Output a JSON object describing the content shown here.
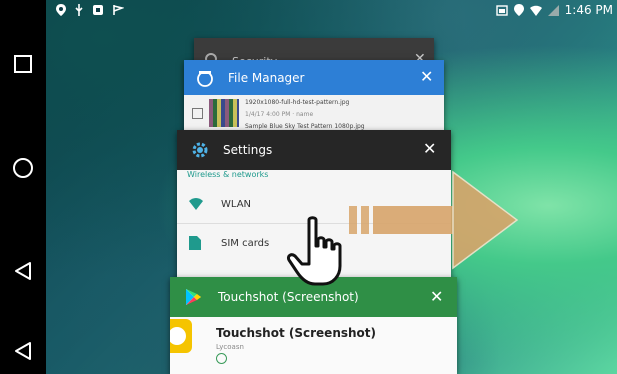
{
  "status_bar": {
    "time": "1:46 PM"
  },
  "recents": {
    "security": {
      "title": "Security",
      "close": "✕"
    },
    "file_manager": {
      "title": "File Manager",
      "close": "✕",
      "items": [
        {
          "name": "1920x1080-full-hd-test-pattern.jpg",
          "meta": "1/4/17 4:00 PM · name"
        },
        {
          "name": "Sample Blue Sky Test Pattern 1080p.jpg"
        }
      ]
    },
    "settings": {
      "title": "Settings",
      "close": "✕",
      "section": "Wireless & networks",
      "items": [
        {
          "label": "WLAN",
          "icon": "wifi-icon"
        },
        {
          "label": "SIM cards",
          "icon": "sim-card-icon"
        }
      ]
    },
    "touchshot": {
      "title": "Touchshot (Screenshot)",
      "close": "✕",
      "app_name": "Touchshot (Screenshot)",
      "developer": "Lycoasn"
    }
  },
  "nav": {
    "buttons": [
      "recent-apps",
      "home",
      "back",
      "back-alt"
    ]
  },
  "colors": {
    "file_manager_header": "#2d7fd6",
    "settings_header": "#262626",
    "touchshot_header": "#2f8f46",
    "swipe_arrow": "#d7a46a"
  }
}
